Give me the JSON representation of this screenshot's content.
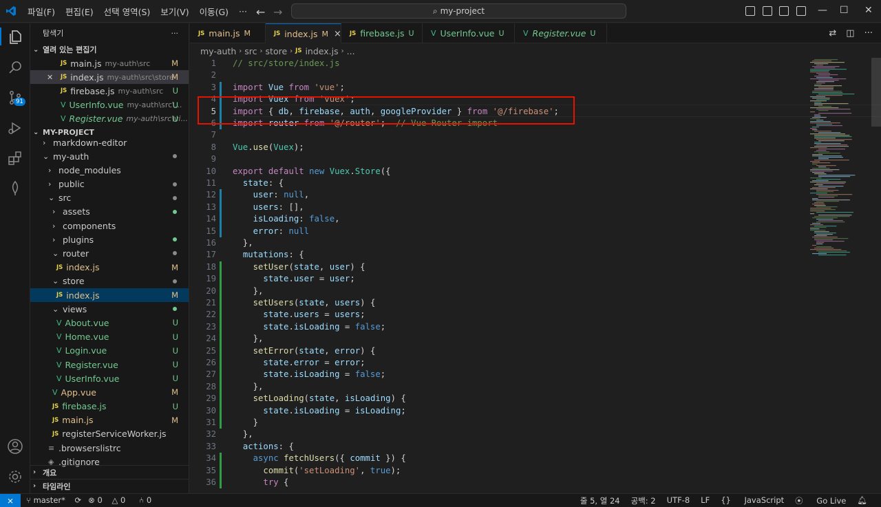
{
  "titlebar": {
    "menus": [
      "파일(F)",
      "편집(E)",
      "선택 영역(S)",
      "보기(V)",
      "이동(G)",
      "···"
    ],
    "search": "my-project"
  },
  "activity": {
    "scm_badge": "91"
  },
  "sidebar": {
    "title": "탐색기",
    "more": "···",
    "open_editors_title": "열려 있는 편집기",
    "open_editors": [
      {
        "icon": "JS",
        "name": "main.js",
        "path": "my-auth\\src",
        "status": "M"
      },
      {
        "icon": "JS",
        "name": "index.js",
        "path": "my-auth\\src\\store",
        "status": "M"
      },
      {
        "icon": "JS",
        "name": "firebase.js",
        "path": "my-auth\\src",
        "status": "U"
      },
      {
        "icon": "V",
        "name": "UserInfo.vue",
        "path": "my-auth\\src\\...",
        "status": "U"
      },
      {
        "icon": "V",
        "name": "Register.vue",
        "path": "my-auth\\src\\vi...",
        "status": "U"
      }
    ],
    "project_title": "MY-PROJECT",
    "tree": [
      {
        "name": "markdown-editor",
        "chev": "›"
      },
      {
        "name": "my-auth",
        "chev": "⌄"
      },
      {
        "name": "node_modules",
        "chev": "›"
      },
      {
        "name": "public",
        "chev": "›"
      },
      {
        "name": "src",
        "chev": "⌄"
      },
      {
        "name": "assets",
        "chev": "›"
      },
      {
        "name": "components",
        "chev": "›"
      },
      {
        "name": "plugins",
        "chev": "›"
      },
      {
        "name": "router",
        "chev": "⌄"
      },
      {
        "name": "index.js",
        "icon": "JS",
        "status": "M"
      },
      {
        "name": "store",
        "chev": "⌄"
      },
      {
        "name": "index.js",
        "icon": "JS",
        "status": "M"
      },
      {
        "name": "views",
        "chev": "⌄"
      },
      {
        "name": "About.vue",
        "icon": "V",
        "status": "U"
      },
      {
        "name": "Home.vue",
        "icon": "V",
        "status": "U"
      },
      {
        "name": "Login.vue",
        "icon": "V",
        "status": "U"
      },
      {
        "name": "Register.vue",
        "icon": "V",
        "status": "U"
      },
      {
        "name": "UserInfo.vue",
        "icon": "V",
        "status": "U"
      },
      {
        "name": "App.vue",
        "icon": "V",
        "status": "M"
      },
      {
        "name": "firebase.js",
        "icon": "JS",
        "status": "U"
      },
      {
        "name": "main.js",
        "icon": "JS",
        "status": "M"
      },
      {
        "name": "registerServiceWorker.js",
        "icon": "JS"
      },
      {
        "name": ".browserslistrc",
        "icon": "≡"
      },
      {
        "name": ".gitignore",
        "icon": "◈"
      }
    ],
    "outline": "개요",
    "timeline": "타임라인"
  },
  "tabs": [
    {
      "icon": "JS",
      "name": "main.js",
      "status": "M"
    },
    {
      "icon": "JS",
      "name": "index.js",
      "status": "M",
      "close": "×"
    },
    {
      "icon": "JS",
      "name": "firebase.js",
      "status": "U"
    },
    {
      "icon": "V",
      "name": "UserInfo.vue",
      "status": "U"
    },
    {
      "icon": "V",
      "name": "Register.vue",
      "status": "U"
    }
  ],
  "breadcrumb": [
    "my-auth",
    "src",
    "store",
    "index.js",
    "..."
  ],
  "statusbar": {
    "branch": "master*",
    "errors": "0",
    "warnings": "0",
    "ports": "0",
    "position": "줄 5, 열 24",
    "spaces": "공백: 2",
    "encoding": "UTF-8",
    "eol": "LF",
    "language": "JavaScript",
    "golive": "Go Live"
  },
  "code_lines": [
    {
      "n": 1,
      "g": "",
      "t": [
        [
          "c",
          "// src/store/index.js"
        ]
      ]
    },
    {
      "n": 2,
      "g": "",
      "t": []
    },
    {
      "n": 3,
      "g": "mod",
      "t": [
        [
          "k",
          "import"
        ],
        [
          "n",
          " "
        ],
        [
          "p",
          "Vue"
        ],
        [
          "n",
          " "
        ],
        [
          "k",
          "from"
        ],
        [
          "n",
          " "
        ],
        [
          "s",
          "'vue'"
        ],
        [
          "n",
          ";"
        ]
      ]
    },
    {
      "n": 4,
      "g": "mod",
      "t": [
        [
          "k",
          "import"
        ],
        [
          "n",
          " "
        ],
        [
          "p",
          "Vuex"
        ],
        [
          "n",
          " "
        ],
        [
          "k",
          "from"
        ],
        [
          "n",
          " "
        ],
        [
          "s",
          "'vuex'"
        ],
        [
          "n",
          ";"
        ]
      ]
    },
    {
      "n": 5,
      "g": "mod",
      "t": [
        [
          "k",
          "import"
        ],
        [
          "n",
          " { "
        ],
        [
          "p",
          "db"
        ],
        [
          "n",
          ", "
        ],
        [
          "p",
          "firebase"
        ],
        [
          "n",
          ", "
        ],
        [
          "p",
          "auth"
        ],
        [
          "n",
          ", "
        ],
        [
          "p",
          "googleProvider"
        ],
        [
          "n",
          " } "
        ],
        [
          "k",
          "from"
        ],
        [
          "n",
          " "
        ],
        [
          "s",
          "'@/firebase'"
        ],
        [
          "n",
          ";"
        ]
      ]
    },
    {
      "n": 6,
      "g": "mod",
      "t": [
        [
          "k",
          "import"
        ],
        [
          "n",
          " "
        ],
        [
          "p",
          "router"
        ],
        [
          "n",
          " "
        ],
        [
          "k",
          "from"
        ],
        [
          "n",
          " "
        ],
        [
          "s",
          "'@/router'"
        ],
        [
          "n",
          ";  "
        ],
        [
          "c",
          "// Vue Router import"
        ]
      ]
    },
    {
      "n": 7,
      "g": "",
      "t": []
    },
    {
      "n": 8,
      "g": "",
      "t": [
        [
          "t",
          "Vue"
        ],
        [
          "n",
          "."
        ],
        [
          "f",
          "use"
        ],
        [
          "n",
          "("
        ],
        [
          "t",
          "Vuex"
        ],
        [
          "n",
          ");"
        ]
      ]
    },
    {
      "n": 9,
      "g": "",
      "t": []
    },
    {
      "n": 10,
      "g": "",
      "t": [
        [
          "k",
          "export"
        ],
        [
          "n",
          " "
        ],
        [
          "k",
          "default"
        ],
        [
          "n",
          " "
        ],
        [
          "kb",
          "new"
        ],
        [
          "n",
          " "
        ],
        [
          "t",
          "Vuex"
        ],
        [
          "n",
          "."
        ],
        [
          "t",
          "Store"
        ],
        [
          "n",
          "({"
        ]
      ]
    },
    {
      "n": 11,
      "g": "",
      "t": [
        [
          "n",
          "  "
        ],
        [
          "p",
          "state"
        ],
        [
          "n",
          ": {"
        ]
      ]
    },
    {
      "n": 12,
      "g": "mod",
      "t": [
        [
          "n",
          "    "
        ],
        [
          "p",
          "user"
        ],
        [
          "n",
          ": "
        ],
        [
          "kb",
          "null"
        ],
        [
          "n",
          ","
        ]
      ]
    },
    {
      "n": 13,
      "g": "mod",
      "t": [
        [
          "n",
          "    "
        ],
        [
          "p",
          "users"
        ],
        [
          "n",
          ": [],"
        ]
      ]
    },
    {
      "n": 14,
      "g": "mod",
      "t": [
        [
          "n",
          "    "
        ],
        [
          "p",
          "isLoading"
        ],
        [
          "n",
          ": "
        ],
        [
          "kb",
          "false"
        ],
        [
          "n",
          ","
        ]
      ]
    },
    {
      "n": 15,
      "g": "mod",
      "t": [
        [
          "n",
          "    "
        ],
        [
          "p",
          "error"
        ],
        [
          "n",
          ": "
        ],
        [
          "kb",
          "null"
        ]
      ]
    },
    {
      "n": 16,
      "g": "",
      "t": [
        [
          "n",
          "  },"
        ]
      ]
    },
    {
      "n": 17,
      "g": "",
      "t": [
        [
          "n",
          "  "
        ],
        [
          "p",
          "mutations"
        ],
        [
          "n",
          ": {"
        ]
      ]
    },
    {
      "n": 18,
      "g": "add",
      "t": [
        [
          "n",
          "    "
        ],
        [
          "f",
          "setUser"
        ],
        [
          "n",
          "("
        ],
        [
          "p",
          "state"
        ],
        [
          "n",
          ", "
        ],
        [
          "p",
          "user"
        ],
        [
          "n",
          ") {"
        ]
      ]
    },
    {
      "n": 19,
      "g": "add",
      "t": [
        [
          "n",
          "      "
        ],
        [
          "p",
          "state"
        ],
        [
          "n",
          "."
        ],
        [
          "p",
          "user"
        ],
        [
          "n",
          " = "
        ],
        [
          "p",
          "user"
        ],
        [
          "n",
          ";"
        ]
      ]
    },
    {
      "n": 20,
      "g": "add",
      "t": [
        [
          "n",
          "    },"
        ]
      ]
    },
    {
      "n": 21,
      "g": "add",
      "t": [
        [
          "n",
          "    "
        ],
        [
          "f",
          "setUsers"
        ],
        [
          "n",
          "("
        ],
        [
          "p",
          "state"
        ],
        [
          "n",
          ", "
        ],
        [
          "p",
          "users"
        ],
        [
          "n",
          ") {"
        ]
      ]
    },
    {
      "n": 22,
      "g": "add",
      "t": [
        [
          "n",
          "      "
        ],
        [
          "p",
          "state"
        ],
        [
          "n",
          "."
        ],
        [
          "p",
          "users"
        ],
        [
          "n",
          " = "
        ],
        [
          "p",
          "users"
        ],
        [
          "n",
          ";"
        ]
      ]
    },
    {
      "n": 23,
      "g": "add",
      "t": [
        [
          "n",
          "      "
        ],
        [
          "p",
          "state"
        ],
        [
          "n",
          "."
        ],
        [
          "p",
          "isLoading"
        ],
        [
          "n",
          " = "
        ],
        [
          "kb",
          "false"
        ],
        [
          "n",
          ";"
        ]
      ]
    },
    {
      "n": 24,
      "g": "add",
      "t": [
        [
          "n",
          "    },"
        ]
      ]
    },
    {
      "n": 25,
      "g": "add",
      "t": [
        [
          "n",
          "    "
        ],
        [
          "f",
          "setError"
        ],
        [
          "n",
          "("
        ],
        [
          "p",
          "state"
        ],
        [
          "n",
          ", "
        ],
        [
          "p",
          "error"
        ],
        [
          "n",
          ") {"
        ]
      ]
    },
    {
      "n": 26,
      "g": "add",
      "t": [
        [
          "n",
          "      "
        ],
        [
          "p",
          "state"
        ],
        [
          "n",
          "."
        ],
        [
          "p",
          "error"
        ],
        [
          "n",
          " = "
        ],
        [
          "p",
          "error"
        ],
        [
          "n",
          ";"
        ]
      ]
    },
    {
      "n": 27,
      "g": "add",
      "t": [
        [
          "n",
          "      "
        ],
        [
          "p",
          "state"
        ],
        [
          "n",
          "."
        ],
        [
          "p",
          "isLoading"
        ],
        [
          "n",
          " = "
        ],
        [
          "kb",
          "false"
        ],
        [
          "n",
          ";"
        ]
      ]
    },
    {
      "n": 28,
      "g": "add",
      "t": [
        [
          "n",
          "    },"
        ]
      ]
    },
    {
      "n": 29,
      "g": "add",
      "t": [
        [
          "n",
          "    "
        ],
        [
          "f",
          "setLoading"
        ],
        [
          "n",
          "("
        ],
        [
          "p",
          "state"
        ],
        [
          "n",
          ", "
        ],
        [
          "p",
          "isLoading"
        ],
        [
          "n",
          ") {"
        ]
      ]
    },
    {
      "n": 30,
      "g": "add",
      "t": [
        [
          "n",
          "      "
        ],
        [
          "p",
          "state"
        ],
        [
          "n",
          "."
        ],
        [
          "p",
          "isLoading"
        ],
        [
          "n",
          " = "
        ],
        [
          "p",
          "isLoading"
        ],
        [
          "n",
          ";"
        ]
      ]
    },
    {
      "n": 31,
      "g": "add",
      "t": [
        [
          "n",
          "    }"
        ]
      ]
    },
    {
      "n": 32,
      "g": "",
      "t": [
        [
          "n",
          "  },"
        ]
      ]
    },
    {
      "n": 33,
      "g": "",
      "t": [
        [
          "n",
          "  "
        ],
        [
          "p",
          "actions"
        ],
        [
          "n",
          ": {"
        ]
      ]
    },
    {
      "n": 34,
      "g": "add",
      "t": [
        [
          "n",
          "    "
        ],
        [
          "kb",
          "async"
        ],
        [
          "n",
          " "
        ],
        [
          "f",
          "fetchUsers"
        ],
        [
          "n",
          "({ "
        ],
        [
          "p",
          "commit"
        ],
        [
          "n",
          " }) {"
        ]
      ]
    },
    {
      "n": 35,
      "g": "add",
      "t": [
        [
          "n",
          "      "
        ],
        [
          "f",
          "commit"
        ],
        [
          "n",
          "("
        ],
        [
          "s",
          "'setLoading'"
        ],
        [
          "n",
          ", "
        ],
        [
          "kb",
          "true"
        ],
        [
          "n",
          ");"
        ]
      ]
    },
    {
      "n": 36,
      "g": "add",
      "t": [
        [
          "n",
          "      "
        ],
        [
          "k",
          "try"
        ],
        [
          "n",
          " {"
        ]
      ]
    }
  ]
}
